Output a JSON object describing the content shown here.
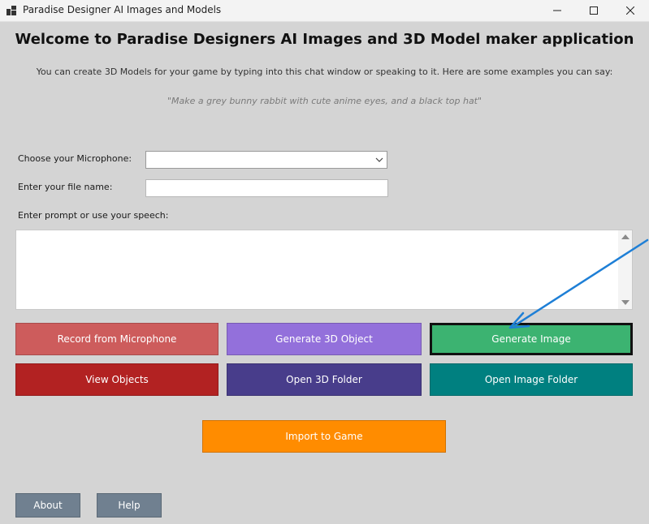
{
  "window": {
    "title": "Paradise Designer AI Images and Models"
  },
  "header": {
    "heading": "Welcome to Paradise Designers AI Images and 3D Model maker application",
    "intro": "You can create 3D Models for your game by typing into this chat window or speaking to it. Here are some examples you can say:",
    "example": "\"Make a grey bunny rabbit with cute anime eyes, and a black top hat\""
  },
  "form": {
    "microphone_label": "Choose your Microphone:",
    "microphone_value": "",
    "filename_label": "Enter your file name:",
    "filename_value": "",
    "prompt_label": "Enter prompt or use your speech:",
    "prompt_value": ""
  },
  "buttons": {
    "record": "Record from Microphone",
    "generate_3d": "Generate 3D Object",
    "generate_image": "Generate Image",
    "view_objects": "View Objects",
    "open_3d_folder": "Open 3D Folder",
    "open_image_folder": "Open Image Folder",
    "import_to_game": "Import to Game",
    "about": "About",
    "help": "Help"
  },
  "colors": {
    "record": "#cd5c5c",
    "generate_3d": "#9370db",
    "generate_image": "#3cb371",
    "view_objects": "#b22222",
    "open_3d_folder": "#483d8b",
    "open_image_folder": "#008080",
    "import_to_game": "#ff8c00",
    "footer_buttons": "#708090",
    "annotation_arrow": "#1e7fd6"
  },
  "icons": {
    "app": "app-window-icon",
    "minimize": "minimize-icon",
    "maximize": "maximize-icon",
    "close": "close-icon",
    "dropdown": "chevron-down-icon"
  }
}
